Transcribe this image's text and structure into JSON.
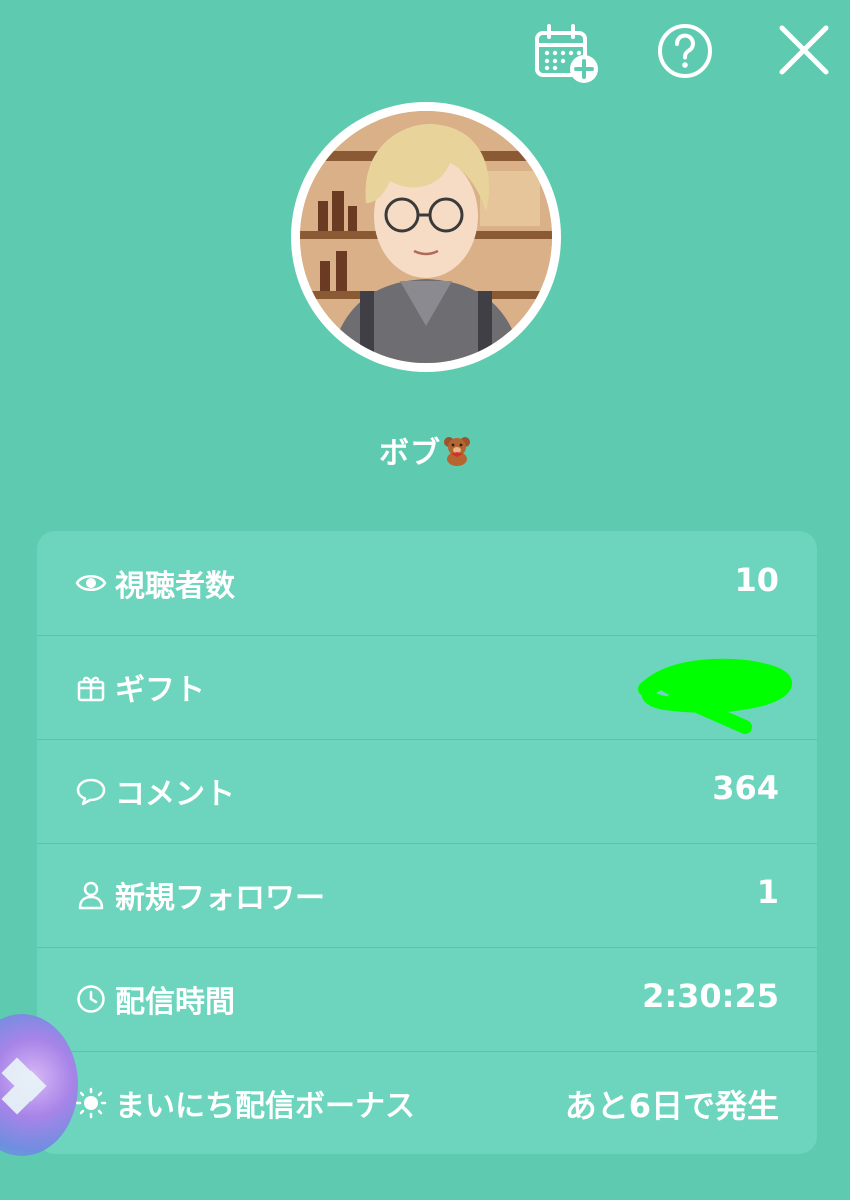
{
  "header": {
    "calendar_add_icon": "calendar-add-icon",
    "help_icon": "help-circle-icon",
    "close_icon": "close-icon"
  },
  "profile": {
    "name": "ボブ",
    "name_emoji": "teddy-bear-icon"
  },
  "stats": [
    {
      "icon": "eye-icon",
      "label": "視聴者数",
      "value": "10"
    },
    {
      "icon": "gift-icon",
      "label": "ギフト",
      "value": ""
    },
    {
      "icon": "comment-icon",
      "label": "コメント",
      "value": "364"
    },
    {
      "icon": "person-icon",
      "label": "新規フォロワー",
      "value": "1"
    },
    {
      "icon": "clock-icon",
      "label": "配信時間",
      "value": "2:30:25"
    },
    {
      "icon": "sun-icon",
      "label": "まいにち配信ボーナス",
      "value": "あと6日で発生"
    }
  ],
  "colors": {
    "background": "#5ecbb0",
    "card": "#6dd5bd",
    "text": "#ffffff",
    "redaction": "#00ff00"
  }
}
